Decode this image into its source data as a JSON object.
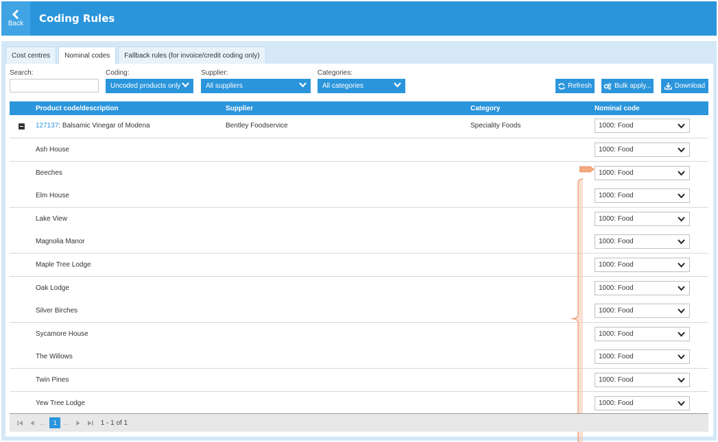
{
  "header": {
    "back_label": "Back",
    "title": "Coding Rules"
  },
  "tabs": [
    {
      "label": "Cost centres",
      "active": false
    },
    {
      "label": "Nominal codes",
      "active": true
    },
    {
      "label": "Fallback rules (for invoice/credit coding only)",
      "active": false
    }
  ],
  "filters": {
    "search_label": "Search:",
    "search_value": "",
    "coding_label": "Coding:",
    "coding_value": "Uncoded products only",
    "supplier_label": "Supplier:",
    "supplier_value": "All suppliers",
    "categories_label": "Categories:",
    "categories_value": "All categories"
  },
  "buttons": {
    "refresh": "Refresh",
    "bulk_apply": "Bulk apply...",
    "download": "Download"
  },
  "table": {
    "columns": [
      "Product code/description",
      "Supplier",
      "Category",
      "Nominal code"
    ],
    "product": {
      "code": "127137",
      "description": ": Balsamic Vinegar of Modena",
      "supplier": "Bentley Foodservice",
      "category": "Speciality Foods",
      "nominal": "1000: Food"
    },
    "sub_rows": [
      {
        "name": "Ash House",
        "nominal": "1000: Food"
      },
      {
        "name": "Beeches",
        "nominal": "1000: Food"
      },
      {
        "name": "Elm House",
        "nominal": "1000: Food"
      },
      {
        "name": "Lake View",
        "nominal": "1000: Food"
      },
      {
        "name": "Magnolia Manor",
        "nominal": "1000: Food"
      },
      {
        "name": "Maple Tree Lodge",
        "nominal": "1000: Food"
      },
      {
        "name": "Oak Lodge",
        "nominal": "1000: Food"
      },
      {
        "name": "Silver Birches",
        "nominal": "1000: Food"
      },
      {
        "name": "Sycamore House",
        "nominal": "1000: Food"
      },
      {
        "name": "The Willows",
        "nominal": "1000: Food"
      },
      {
        "name": "Twin Pines",
        "nominal": "1000: Food"
      },
      {
        "name": "Yew Tree Lodge",
        "nominal": "1000: Food"
      }
    ]
  },
  "pager": {
    "current": "1",
    "dots": "...",
    "info": "1 - 1 of 1"
  },
  "colors": {
    "primary": "#2b95db",
    "panel": "#d4e8f7",
    "annotation": "#f4a97f"
  }
}
